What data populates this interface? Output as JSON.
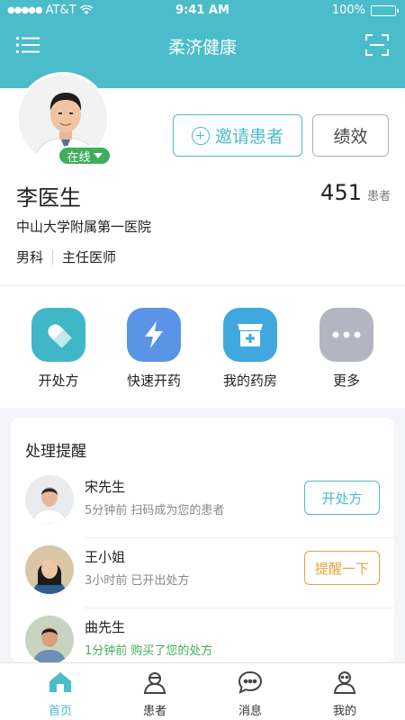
{
  "status_bar": {
    "carrier": "AT&T",
    "time": "9:41 AM",
    "battery": "100%"
  },
  "nav": {
    "title": "柔济健康",
    "menu_icon": "menu-icon",
    "scan_icon": "scan-icon"
  },
  "profile": {
    "online_status": "在线",
    "invite_label": "邀请患者",
    "performance_label": "绩效",
    "name": "李医生",
    "patient_count": "451",
    "patient_count_label": "患者",
    "hospital": "中山大学附属第一医院",
    "department": "男科",
    "title": "主任医师"
  },
  "quick_actions": [
    {
      "label": "开处方",
      "icon": "pill-icon",
      "color": "#3fb7c6"
    },
    {
      "label": "快速开药",
      "icon": "lightning-icon",
      "color": "#5b93e6"
    },
    {
      "label": "我的药房",
      "icon": "pharmacy-icon",
      "color": "#3fa9de"
    },
    {
      "label": "更多",
      "icon": "more-icon",
      "color": "#b3b6c2"
    }
  ],
  "reminders": {
    "title": "处理提醒",
    "items": [
      {
        "name": "宋先生",
        "time": "5分钟前",
        "desc": "扫码成为您的患者",
        "action": "开处方",
        "action_color": "#4bbcc9"
      },
      {
        "name": "王小姐",
        "time": "3小时前",
        "desc": "已开出处方",
        "action": "提醒一下",
        "action_color": "#e8a33a"
      },
      {
        "name": "曲先生",
        "time": "1分钟前",
        "desc": "购买了您的处方",
        "desc_color": "#3fae5c"
      }
    ]
  },
  "tabs": [
    {
      "label": "首页",
      "icon": "home-icon",
      "active": true
    },
    {
      "label": "患者",
      "icon": "patient-icon",
      "active": false
    },
    {
      "label": "消息",
      "icon": "message-icon",
      "active": false
    },
    {
      "label": "我的",
      "icon": "profile-icon",
      "active": false
    }
  ],
  "colors": {
    "primary": "#4bbcc9",
    "online": "#3fae5c",
    "warning": "#e8a33a"
  }
}
